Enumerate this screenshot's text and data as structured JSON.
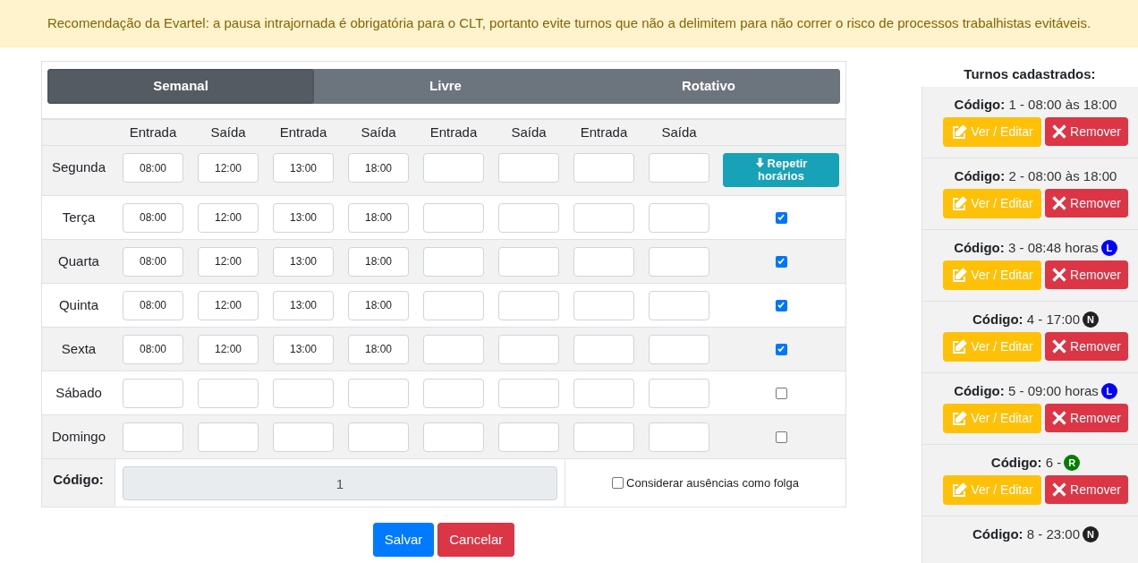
{
  "alert": {
    "text": "Recomendação da Evartel: a pausa intrajornada é obrigatória para o CLT, portanto evite turnos que não a delimitem para não correr o risco de processos trabalhistas evitáveis."
  },
  "tabs": [
    {
      "label": "Semanal",
      "selected": true
    },
    {
      "label": "Livre",
      "selected": false
    },
    {
      "label": "Rotativo",
      "selected": false
    }
  ],
  "schedule": {
    "columns": [
      "Entrada",
      "Saída",
      "Entrada",
      "Saída",
      "Entrada",
      "Saída",
      "Entrada",
      "Saída"
    ],
    "rows": [
      {
        "day": "Segunda",
        "times": [
          "08:00",
          "12:00",
          "13:00",
          "18:00"
        ],
        "kind": "button",
        "button_label": "Repetir horários"
      },
      {
        "day": "Terça",
        "times": [
          "08:00",
          "12:00",
          "13:00",
          "18:00"
        ],
        "kind": "checkbox",
        "checked": true
      },
      {
        "day": "Quarta",
        "times": [
          "08:00",
          "12:00",
          "13:00",
          "18:00"
        ],
        "kind": "checkbox",
        "checked": true
      },
      {
        "day": "Quinta",
        "times": [
          "08:00",
          "12:00",
          "13:00",
          "18:00"
        ],
        "kind": "checkbox",
        "checked": true
      },
      {
        "day": "Sexta",
        "times": [
          "08:00",
          "12:00",
          "13:00",
          "18:00"
        ],
        "kind": "checkbox",
        "checked": true
      },
      {
        "day": "Sábado",
        "times": [],
        "kind": "checkbox",
        "checked": false
      },
      {
        "day": "Domingo",
        "times": [],
        "kind": "checkbox",
        "checked": false
      }
    ]
  },
  "code": {
    "label": "Código:",
    "value": "1"
  },
  "absence_option": {
    "label": "Considerar ausências como folga",
    "checked": false
  },
  "buttons": {
    "save": "Salvar",
    "cancel": "Cancelar"
  },
  "sidebar": {
    "title": "Turnos cadastrados:",
    "shifts": [
      {
        "code_label": "Código:",
        "text": "1 - 08:00 às 18:00",
        "edit": "Ver / Editar",
        "remove": "Remover"
      },
      {
        "code_label": "Código:",
        "text": "2 - 08:00 às 18:00",
        "edit": "Ver / Editar",
        "remove": "Remover"
      },
      {
        "code_label": "Código:",
        "text": "3 - 08:48 horas",
        "badge": {
          "letter": "L",
          "color": "#0000ff"
        },
        "edit": "Ver / Editar",
        "remove": "Remover"
      },
      {
        "code_label": "Código:",
        "text": "4 - 17:00",
        "badge": {
          "letter": "N",
          "color": "#212121"
        },
        "edit": "Ver / Editar",
        "remove": "Remover"
      },
      {
        "code_label": "Código:",
        "text": "5 - 09:00 horas",
        "badge": {
          "letter": "L",
          "color": "#0000ff"
        },
        "edit": "Ver / Editar",
        "remove": "Remover"
      },
      {
        "code_label": "Código:",
        "text": "6 -",
        "badge": {
          "letter": "R",
          "color": "#008000"
        },
        "edit": "Ver / Editar",
        "remove": "Remover"
      },
      {
        "code_label": "Código:",
        "text": "8 - 23:00",
        "badge": {
          "letter": "N",
          "color": "#212121"
        }
      }
    ]
  }
}
